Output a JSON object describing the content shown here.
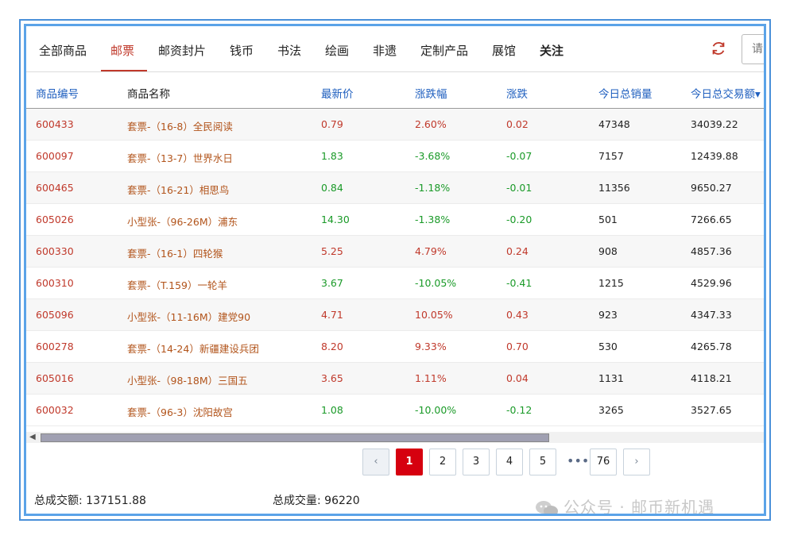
{
  "tabs": [
    {
      "label": "全部商品"
    },
    {
      "label": "邮票"
    },
    {
      "label": "邮资封片"
    },
    {
      "label": "钱币"
    },
    {
      "label": "书法"
    },
    {
      "label": "绘画"
    },
    {
      "label": "非遗"
    },
    {
      "label": "定制产品"
    },
    {
      "label": "展馆"
    },
    {
      "label": "关注"
    }
  ],
  "active_tab": "邮票",
  "search": {
    "placeholder": "请"
  },
  "columns": [
    "商品编号",
    "商品名称",
    "最新价",
    "涨跌幅",
    "涨跌",
    "今日总销量",
    "今日总交易额▾"
  ],
  "rows": [
    {
      "code": "600433",
      "name": "套票-（16-8）全民阅读",
      "price": "0.79",
      "pct": "2.60%",
      "chg": "0.02",
      "vol": "47348",
      "amt": "34039.22",
      "dir": "up"
    },
    {
      "code": "600097",
      "name": "套票-（13-7）世界水日",
      "price": "1.83",
      "pct": "-3.68%",
      "chg": "-0.07",
      "vol": "7157",
      "amt": "12439.88",
      "dir": "down"
    },
    {
      "code": "600465",
      "name": "套票-（16-21）相思鸟",
      "price": "0.84",
      "pct": "-1.18%",
      "chg": "-0.01",
      "vol": "11356",
      "amt": "9650.27",
      "dir": "down"
    },
    {
      "code": "605026",
      "name": "小型张-（96-26M）浦东",
      "price": "14.30",
      "pct": "-1.38%",
      "chg": "-0.20",
      "vol": "501",
      "amt": "7266.65",
      "dir": "down"
    },
    {
      "code": "600330",
      "name": "套票-（16-1）四轮猴",
      "price": "5.25",
      "pct": "4.79%",
      "chg": "0.24",
      "vol": "908",
      "amt": "4857.36",
      "dir": "up"
    },
    {
      "code": "600310",
      "name": "套票-（T.159）一轮羊",
      "price": "3.67",
      "pct": "-10.05%",
      "chg": "-0.41",
      "vol": "1215",
      "amt": "4529.96",
      "dir": "down"
    },
    {
      "code": "605096",
      "name": "小型张-（11-16M）建党90",
      "price": "4.71",
      "pct": "10.05%",
      "chg": "0.43",
      "vol": "923",
      "amt": "4347.33",
      "dir": "up"
    },
    {
      "code": "600278",
      "name": "套票-（14-24）新疆建设兵团",
      "price": "8.20",
      "pct": "9.33%",
      "chg": "0.70",
      "vol": "530",
      "amt": "4265.78",
      "dir": "up"
    },
    {
      "code": "605016",
      "name": "小型张-（98-18M）三国五",
      "price": "3.65",
      "pct": "1.11%",
      "chg": "0.04",
      "vol": "1131",
      "amt": "4118.21",
      "dir": "up"
    },
    {
      "code": "600032",
      "name": "套票-（96-3）沈阳故宫",
      "price": "1.08",
      "pct": "-10.00%",
      "chg": "-0.12",
      "vol": "3265",
      "amt": "3527.65",
      "dir": "down"
    }
  ],
  "pagination": {
    "prev": "‹",
    "pages": [
      "1",
      "2",
      "3",
      "4",
      "5"
    ],
    "ellipsis": "•••",
    "last": "76",
    "next": "›",
    "current": "1"
  },
  "footer": {
    "total_amount_label": "总成交额:",
    "total_amount": "137151.88",
    "total_volume_label": "总成交量:",
    "total_volume": "96220"
  },
  "watermark": "公众号 · 邮币新机遇",
  "colors": {
    "up": "#c0392b",
    "down": "#1a9a28",
    "accent": "#d6000f",
    "frame": "#5ba3e8",
    "header_blue": "#1f5fbf"
  }
}
